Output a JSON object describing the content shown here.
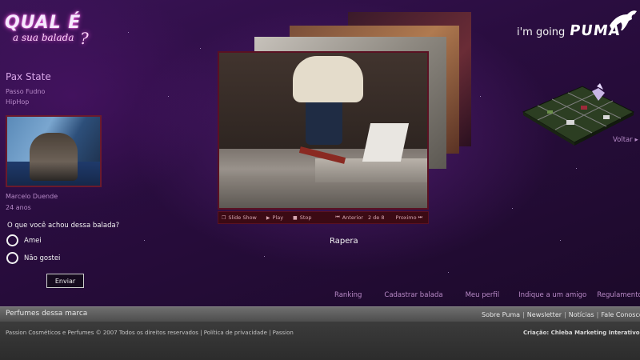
{
  "logo": {
    "line1": "QUAL É",
    "line2": "a sua balada",
    "mark": "?"
  },
  "venue": {
    "name": "Pax State",
    "city": "Passo Fudno",
    "genre": "HipHop"
  },
  "profile": {
    "name": "Marcelo Duende",
    "age": "24 anos"
  },
  "poll": {
    "question": "O que você achou dessa balada?",
    "options": [
      "Amei",
      "Não gostei"
    ],
    "submit_label": "Enviar"
  },
  "slideshow": {
    "slideshow_label": "Slide Show",
    "play_label": "Play",
    "stop_label": "Stop",
    "prev_label": "Anterior",
    "counter": "2 de 8",
    "next_label": "Proximo",
    "caption": "Rapera"
  },
  "brand": {
    "tagline": "i'm going",
    "logo": "PUMA"
  },
  "back_link": "Voltar ▸",
  "site_nav": [
    "Ranking",
    "Cadastrar balada",
    "Meu perfil",
    "Indique a um amigo",
    "Regulamento"
  ],
  "footer": {
    "left_label": "Perfumes dessa marca",
    "links": [
      "Sobre Puma",
      "Newsletter",
      "Notícias",
      "Fale Conosco"
    ],
    "copyright": "Passion Cosméticos e Perfumes © 2007 Todos os direitos reservados | Política de privacidade | Passion",
    "credits": "Criação: Chleba Marketing Interativo"
  },
  "colors": {
    "background": "#2a0d40",
    "accent_pink": "#e04bd0",
    "photo_border": "#5a1122",
    "link_lilac": "#b889c6"
  },
  "icons": [
    "slideshow-icon",
    "play-icon",
    "stop-icon",
    "prev-icon",
    "next-icon",
    "puma-cat-icon",
    "iso-map-icon"
  ]
}
